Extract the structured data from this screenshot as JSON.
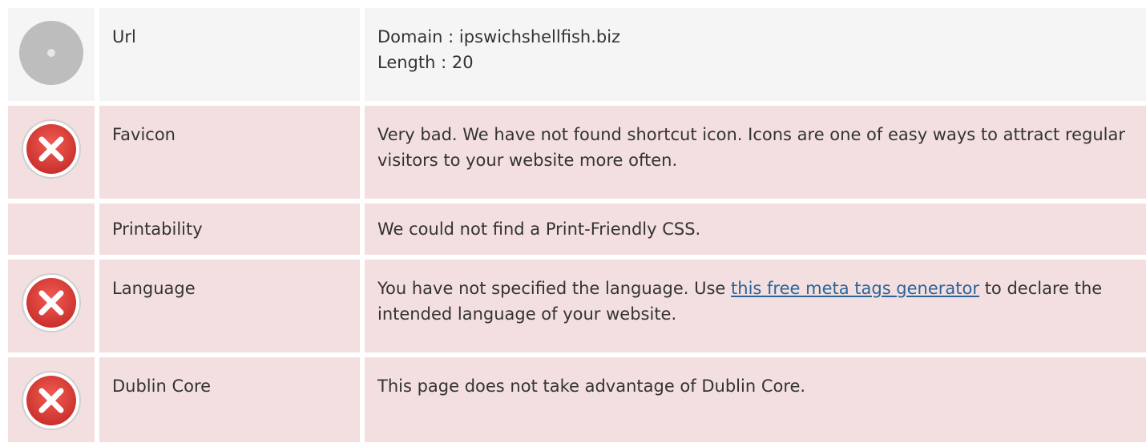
{
  "rows": [
    {
      "status": "neutral",
      "label": "Url",
      "value_lines": [
        "Domain : ipswichshellfish.biz",
        "Length : 20"
      ]
    },
    {
      "status": "bad",
      "label": "Favicon",
      "value": "Very bad. We have not found shortcut icon. Icons are one of easy ways to attract regular visitors to your website more often."
    },
    {
      "status": "bad",
      "label": "Printability",
      "value": "We could not find a Print-Friendly CSS."
    },
    {
      "status": "bad",
      "label": "Language",
      "value_before": "You have not specified the language. Use ",
      "link_text": "this free meta tags generator",
      "value_after": " to declare the intended language of your website."
    },
    {
      "status": "bad",
      "label": "Dublin Core",
      "value": "This page does not take advantage of Dublin Core."
    }
  ],
  "icons": {
    "neutral": "disc-icon",
    "error": "error-x-icon"
  },
  "colors": {
    "neutral_bg": "#f5f5f5",
    "bad_bg": "#f3dfe0",
    "error_red": "#e2463c",
    "link": "#2a6496"
  }
}
